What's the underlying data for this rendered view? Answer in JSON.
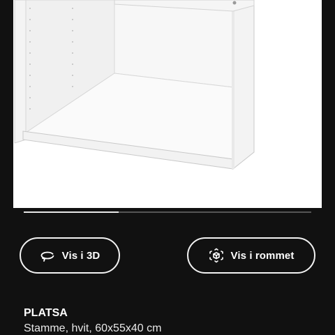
{
  "product_image": {
    "alt_icon": "open-frame-cabinet"
  },
  "carousel": {
    "progress_fraction": 0.33
  },
  "actions": {
    "view_3d_label": "Vis i 3D",
    "view_3d_icon": "rotate-360-icon",
    "view_in_room_label": "Vis i rommet",
    "view_in_room_icon": "ar-cube-icon"
  },
  "product": {
    "name": "PLATSA",
    "description": "Stamme, hvit, 60x55x40 cm"
  },
  "colors": {
    "background": "#111111",
    "image_background": "#ffffff",
    "button_border": "#f2f2f2"
  }
}
